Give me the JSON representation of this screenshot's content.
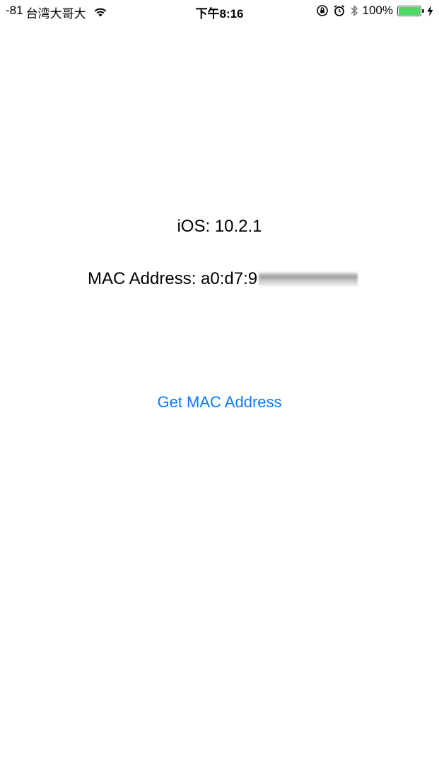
{
  "status_bar": {
    "signal": "-81",
    "carrier": "台湾大哥大",
    "time": "下午8:16",
    "battery_percent_text": "100%",
    "battery_level": 1.0,
    "icons": [
      "wifi-icon",
      "orientation-lock-icon",
      "alarm-icon",
      "bluetooth-icon",
      "battery-icon",
      "charging-icon"
    ],
    "battery_color": "#4cd964"
  },
  "main": {
    "ios_version_text": "iOS: 10.2.1",
    "mac_address_text": "MAC Address: a0:d7:9",
    "button_label": "Get MAC Address",
    "button_color": "#0a7aff"
  }
}
